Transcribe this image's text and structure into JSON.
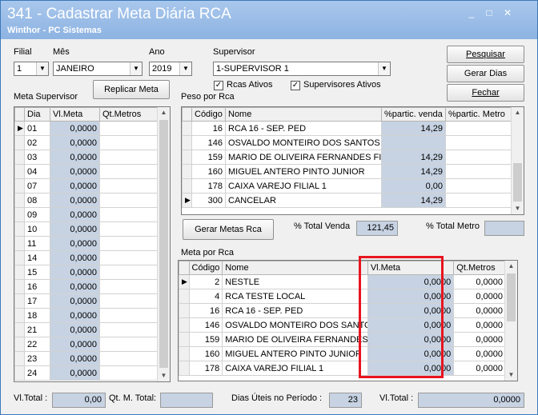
{
  "window": {
    "title": "341 - Cadastrar Meta Diária RCA",
    "subtitle": "Winthor - PC Sistemas",
    "minimize": "_",
    "maximize": "□",
    "close": "✕"
  },
  "filters": {
    "filial_label": "Filial",
    "filial_value": "1",
    "mes_label": "Mês",
    "mes_value": "JANEIRO",
    "ano_label": "Ano",
    "ano_value": "2019",
    "supervisor_label": "Supervisor",
    "supervisor_value": "1-SUPERVISOR 1",
    "rcas_ativos_label": "Rcas Ativos",
    "supervisores_ativos_label": "Supervisores Ativos"
  },
  "buttons": {
    "pesquisar": "Pesquisar",
    "gerar_dias": "Gerar Dias",
    "fechar": "Fechar",
    "replicar_meta": "Replicar Meta",
    "gerar_metas_rca": "Gerar Metas Rca"
  },
  "meta_supervisor": {
    "label": "Meta Supervisor",
    "columns": [
      "Dia",
      "Vl.Meta",
      "Qt.Metros"
    ],
    "rows": [
      {
        "dia": "01",
        "vl_meta": "0,0000"
      },
      {
        "dia": "02",
        "vl_meta": "0,0000"
      },
      {
        "dia": "03",
        "vl_meta": "0,0000"
      },
      {
        "dia": "04",
        "vl_meta": "0,0000"
      },
      {
        "dia": "07",
        "vl_meta": "0,0000"
      },
      {
        "dia": "08",
        "vl_meta": "0,0000"
      },
      {
        "dia": "09",
        "vl_meta": "0,0000"
      },
      {
        "dia": "10",
        "vl_meta": "0,0000"
      },
      {
        "dia": "11",
        "vl_meta": "0,0000"
      },
      {
        "dia": "14",
        "vl_meta": "0,0000"
      },
      {
        "dia": "15",
        "vl_meta": "0,0000"
      },
      {
        "dia": "16",
        "vl_meta": "0,0000"
      },
      {
        "dia": "17",
        "vl_meta": "0,0000"
      },
      {
        "dia": "18",
        "vl_meta": "0,0000"
      },
      {
        "dia": "21",
        "vl_meta": "0,0000"
      },
      {
        "dia": "22",
        "vl_meta": "0,0000"
      },
      {
        "dia": "23",
        "vl_meta": "0,0000"
      },
      {
        "dia": "24",
        "vl_meta": "0,0000"
      }
    ]
  },
  "peso_por_rca": {
    "label": "Peso por Rca",
    "columns": [
      "Código",
      "Nome",
      "%partic. venda",
      "%partic. Metro"
    ],
    "rows": [
      {
        "codigo": "16",
        "nome": "RCA 16 - SEP. PED",
        "venda": "14,29",
        "metro": ""
      },
      {
        "codigo": "146",
        "nome": "OSVALDO MONTEIRO DOS SANTOS",
        "venda": "",
        "metro": ""
      },
      {
        "codigo": "159",
        "nome": "MARIO DE OLIVEIRA FERNANDES FILHO",
        "venda": "14,29",
        "metro": ""
      },
      {
        "codigo": "160",
        "nome": "MIGUEL ANTERO PINTO JUNIOR",
        "venda": "14,29",
        "metro": ""
      },
      {
        "codigo": "178",
        "nome": "CAIXA VAREJO FILIAL 1",
        "venda": "0,00",
        "metro": ""
      },
      {
        "codigo": "300",
        "nome": "CANCELAR",
        "venda": "14,29",
        "metro": ""
      }
    ]
  },
  "totals": {
    "total_venda_label": "% Total Venda",
    "total_venda_value": "121,45",
    "total_metro_label": "% Total Metro",
    "total_metro_value": ""
  },
  "meta_por_rca": {
    "label": "Meta por Rca",
    "columns": [
      "Código",
      "Nome",
      "Vl.Meta",
      "Qt.Metros"
    ],
    "rows": [
      {
        "codigo": "2",
        "nome": "NESTLE",
        "vl_meta": "0,0000",
        "qt": "0,0000"
      },
      {
        "codigo": "4",
        "nome": "RCA TESTE LOCAL",
        "vl_meta": "0,0000",
        "qt": "0,0000"
      },
      {
        "codigo": "16",
        "nome": "RCA 16 - SEP. PED",
        "vl_meta": "0,0000",
        "qt": "0,0000"
      },
      {
        "codigo": "146",
        "nome": "OSVALDO MONTEIRO DOS SANTOS",
        "vl_meta": "0,0000",
        "qt": "0,0000"
      },
      {
        "codigo": "159",
        "nome": "MARIO DE OLIVEIRA FERNANDES F",
        "vl_meta": "0,0000",
        "qt": "0,0000"
      },
      {
        "codigo": "160",
        "nome": "MIGUEL ANTERO PINTO JUNIOR",
        "vl_meta": "0,0000",
        "qt": "0,0000"
      },
      {
        "codigo": "178",
        "nome": "CAIXA VAREJO FILIAL 1",
        "vl_meta": "0,0000",
        "qt": "0,0000"
      }
    ]
  },
  "footer": {
    "vl_total_label": "Vl.Total :",
    "vl_total_value": "0,00",
    "qt_m_total_label": "Qt. M. Total:",
    "qt_m_total_value": "",
    "dias_uteis_label": "Dias Úteis no Período :",
    "dias_uteis_value": "23",
    "vl_total2_label": "Vl.Total :",
    "vl_total2_value": "0,0000"
  },
  "colors": {
    "titlebar": "#8db3e2",
    "readonly_cell": "#c7d3e3",
    "highlight": "#e8141f"
  }
}
